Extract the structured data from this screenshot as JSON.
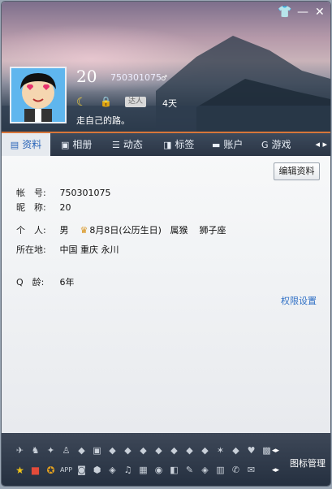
{
  "window": {
    "controls": [
      "👕",
      "—",
      "✕"
    ]
  },
  "profile": {
    "level": "20",
    "qq_number": "750301075",
    "online_days": "4天",
    "badge_text": "达人",
    "signature": "走自己的路。"
  },
  "tabs": [
    {
      "label": "资料",
      "icon": "profile-card-icon"
    },
    {
      "label": "相册",
      "icon": "photo-album-icon"
    },
    {
      "label": "动态",
      "icon": "feed-icon"
    },
    {
      "label": "标签",
      "icon": "tag-icon"
    },
    {
      "label": "账户",
      "icon": "wallet-icon"
    },
    {
      "label": "游戏",
      "icon": "game-icon"
    }
  ],
  "info": {
    "edit_button": "编辑资料",
    "account_label": "帐　号:",
    "account_value": "750301075",
    "nickname_label": "昵　称:",
    "nickname_value": "20",
    "personal_label": "个　人:",
    "gender": "男",
    "birthday": "8月8日(公历生日)",
    "zodiac": "属猴",
    "constellation": "狮子座",
    "location_label": "所在地:",
    "location_value": "中国 重庆 永川",
    "qage_label": "Q　龄:",
    "qage_value": "6年",
    "permission_link": "权限设置"
  },
  "bottom": {
    "icon_manager": "图标管理",
    "row1_icons": [
      "plane-icon",
      "sprite-icon",
      "pet-icon",
      "figure-icon",
      "diamond-icon",
      "monitor-icon",
      "diamond-icon",
      "diamond-icon",
      "diamond-icon",
      "diamond-icon",
      "diamond-icon",
      "diamond-icon",
      "diamond-icon",
      "star-icon",
      "diamond-icon",
      "heart-icon",
      "vip-icon"
    ],
    "row2_icons": [
      "star-icon",
      "bag-icon",
      "game-icon",
      "app-icon",
      "camera-icon",
      "cube-icon",
      "shield-icon",
      "music-icon",
      "film-icon",
      "disc-icon",
      "tag-icon",
      "brush-icon",
      "shield-icon",
      "book-icon",
      "phone-icon",
      "mail-icon"
    ]
  }
}
